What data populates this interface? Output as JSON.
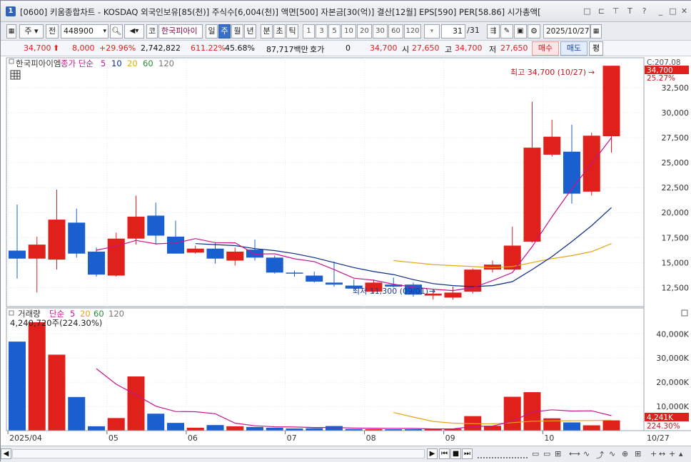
{
  "window": {
    "badge": "1",
    "title": "[0600] 키움종합차트 - KOSDAQ 외국인보유[85(천)] 주식수[6,004(천)] 액면[500] 자본금[30(억)] 결산[12월] EPS[590] PER[58.86] 시가총액[",
    "controls": [
      "□",
      "⊏",
      "⊤",
      "T",
      "?",
      "_",
      "□",
      "✕"
    ]
  },
  "toolbar": {
    "market": "주",
    "prev": "전",
    "code": "448900",
    "search_icon": "search-icon",
    "sound_icon": "speaker-icon",
    "code_prefix": "코",
    "stock_name": "한국피아이",
    "periods": [
      "일",
      "주",
      "월",
      "년",
      "분",
      "초",
      "틱"
    ],
    "selected_period": "주",
    "intervals": [
      "1",
      "3",
      "5",
      "10",
      "20",
      "30",
      "60",
      "120"
    ],
    "count": "31",
    "count_total": "/31",
    "date": "2025/10/27"
  },
  "quote": {
    "price": "34,700",
    "change": "8,000",
    "change_pct": "+29.96%",
    "volume": "2,742,822",
    "volume_ratio": "611.22%",
    "turnover": "45.68%",
    "amount": "87,717백만",
    "hoga_label": "호가",
    "hoga_value": "0",
    "ask_price": "34,700",
    "open_label": "시",
    "open": "27,650",
    "high_label": "고",
    "high": "34,700",
    "low_label": "저",
    "low": "27,650",
    "buy": "매수",
    "sell": "매도",
    "avg": "평"
  },
  "price_panel": {
    "name": "한국피아이엠",
    "ma_label": "종가 단순",
    "ma_periods": [
      "5",
      "10",
      "20",
      "60",
      "120"
    ],
    "ma_colors": [
      "#c8148c",
      "#0a2a88",
      "#e8a418",
      "#2a8a3a",
      "#666666"
    ],
    "high_annot": "최고 34,700 (10/27)",
    "low_annot": "최저 11,300 (09/01)",
    "right_top": "C:207.08",
    "right_pct": "25.27%",
    "cur_box": "34,700",
    "y_ticks": [
      "32,500",
      "30,000",
      "27,500",
      "25,000",
      "22,500",
      "20,000",
      "17,500",
      "15,000",
      "12,500"
    ]
  },
  "volume_panel": {
    "title": "거래량",
    "ma_label": "단순",
    "ma_periods": [
      "5",
      "20",
      "60",
      "120"
    ],
    "value_text": "4,240,720주(224.30%)",
    "cur_box": "4,241K",
    "cur_pct": "224.30%",
    "y_ticks": [
      "40,000K",
      "30,000K",
      "20,000K",
      "10,000K"
    ]
  },
  "x_labels": [
    "2025/04",
    "05",
    "06",
    "07",
    "08",
    "09",
    "10"
  ],
  "x_right": "10/27",
  "chart_data": {
    "type": "candlestick",
    "period": "weekly",
    "candles": [
      {
        "o": 16200,
        "h": 20800,
        "l": 13400,
        "c": 15400
      },
      {
        "o": 15400,
        "h": 17600,
        "l": 12000,
        "c": 16800
      },
      {
        "o": 15300,
        "h": 22300,
        "l": 14300,
        "c": 19300
      },
      {
        "o": 19000,
        "h": 20400,
        "l": 15500,
        "c": 15900
      },
      {
        "o": 16100,
        "h": 16500,
        "l": 13600,
        "c": 13800
      },
      {
        "o": 13700,
        "h": 18000,
        "l": 13600,
        "c": 17400
      },
      {
        "o": 17400,
        "h": 21700,
        "l": 16800,
        "c": 19600
      },
      {
        "o": 19700,
        "h": 21000,
        "l": 16800,
        "c": 17700
      },
      {
        "o": 17600,
        "h": 19200,
        "l": 15900,
        "c": 15900
      },
      {
        "o": 16000,
        "h": 16700,
        "l": 15900,
        "c": 16400
      },
      {
        "o": 16400,
        "h": 17000,
        "l": 14900,
        "c": 15400
      },
      {
        "o": 15200,
        "h": 16500,
        "l": 14700,
        "c": 16100
      },
      {
        "o": 16300,
        "h": 17300,
        "l": 15200,
        "c": 15500
      },
      {
        "o": 15500,
        "h": 15700,
        "l": 13900,
        "c": 14000
      },
      {
        "o": 14000,
        "h": 14200,
        "l": 13600,
        "c": 13900
      },
      {
        "o": 13700,
        "h": 14100,
        "l": 13000,
        "c": 13100
      },
      {
        "o": 13000,
        "h": 15100,
        "l": 12600,
        "c": 12800
      },
      {
        "o": 12700,
        "h": 13300,
        "l": 12200,
        "c": 12400
      },
      {
        "o": 12100,
        "h": 13300,
        "l": 11900,
        "c": 13000
      },
      {
        "o": 12800,
        "h": 13500,
        "l": 12500,
        "c": 12600
      },
      {
        "o": 12800,
        "h": 13000,
        "l": 11600,
        "c": 11800
      },
      {
        "o": 11700,
        "h": 12300,
        "l": 11300,
        "c": 11900
      },
      {
        "o": 11500,
        "h": 12600,
        "l": 11300,
        "c": 12000
      },
      {
        "o": 12100,
        "h": 14400,
        "l": 11900,
        "c": 14300
      },
      {
        "o": 14300,
        "h": 15200,
        "l": 14000,
        "c": 14800
      },
      {
        "o": 14300,
        "h": 18600,
        "l": 14300,
        "c": 16700
      },
      {
        "o": 17100,
        "h": 31100,
        "l": 17000,
        "c": 26500
      },
      {
        "o": 25800,
        "h": 29300,
        "l": 25600,
        "c": 27600
      },
      {
        "o": 26100,
        "h": 28800,
        "l": 20900,
        "c": 21900
      },
      {
        "o": 22100,
        "h": 28000,
        "l": 21700,
        "c": 27700
      },
      {
        "o": 27650,
        "h": 34700,
        "l": 26000,
        "c": 34700
      }
    ],
    "ma5": [
      null,
      null,
      null,
      null,
      16240,
      16640,
      17220,
      16880,
      16960,
      17400,
      17000,
      16980,
      15860,
      15880,
      15380,
      15100,
      14300,
      13440,
      13240,
      12840,
      12540,
      12340,
      12200,
      12500,
      13200,
      14000,
      16600,
      19600,
      22400,
      24900,
      27500
    ],
    "ma10": [
      null,
      null,
      null,
      null,
      null,
      null,
      null,
      null,
      null,
      16900,
      16800,
      16700,
      16400,
      16200,
      15900,
      15500,
      15000,
      14500,
      14100,
      13800,
      13300,
      12900,
      12700,
      12600,
      12700,
      13100,
      14300,
      15600,
      17100,
      18700,
      20500
    ],
    "ma20": [
      null,
      null,
      null,
      null,
      null,
      null,
      null,
      null,
      null,
      null,
      null,
      null,
      null,
      null,
      null,
      null,
      null,
      null,
      null,
      15200,
      15000,
      14800,
      14700,
      14600,
      14500,
      14600,
      15000,
      15400,
      15700,
      16100,
      16900
    ],
    "volume": [
      36800,
      44800,
      31400,
      13900,
      1800,
      5200,
      22400,
      7000,
      3200,
      1200,
      2300,
      1800,
      1500,
      1200,
      900,
      1000,
      1900,
      700,
      600,
      600,
      600,
      800,
      800,
      6000,
      2000,
      14000,
      15900,
      5100,
      3400,
      2200,
      4241
    ],
    "volume_ma5": [
      null,
      null,
      null,
      null,
      25600,
      19200,
      14800,
      10100,
      7900,
      7800,
      7000,
      3100,
      2000,
      1600,
      1500,
      1300,
      1300,
      1100,
      1000,
      950,
      900,
      700,
      700,
      1700,
      1900,
      3900,
      7700,
      8600,
      8100,
      8200,
      6200
    ],
    "volume_ma20": [
      null,
      null,
      null,
      null,
      null,
      null,
      null,
      null,
      null,
      null,
      null,
      null,
      null,
      null,
      null,
      null,
      null,
      null,
      null,
      7500,
      5600,
      3800,
      3100,
      2900,
      2800,
      3300,
      3900,
      4000,
      4100,
      4200,
      4300
    ],
    "y_range_price": [
      10600,
      35500
    ],
    "y_range_volume": [
      0,
      44800
    ],
    "x_labels": [
      "2025/04",
      "05",
      "06",
      "07",
      "08",
      "09",
      "10"
    ],
    "up_color": "#e0201a",
    "down_color": "#1a5fd0"
  }
}
